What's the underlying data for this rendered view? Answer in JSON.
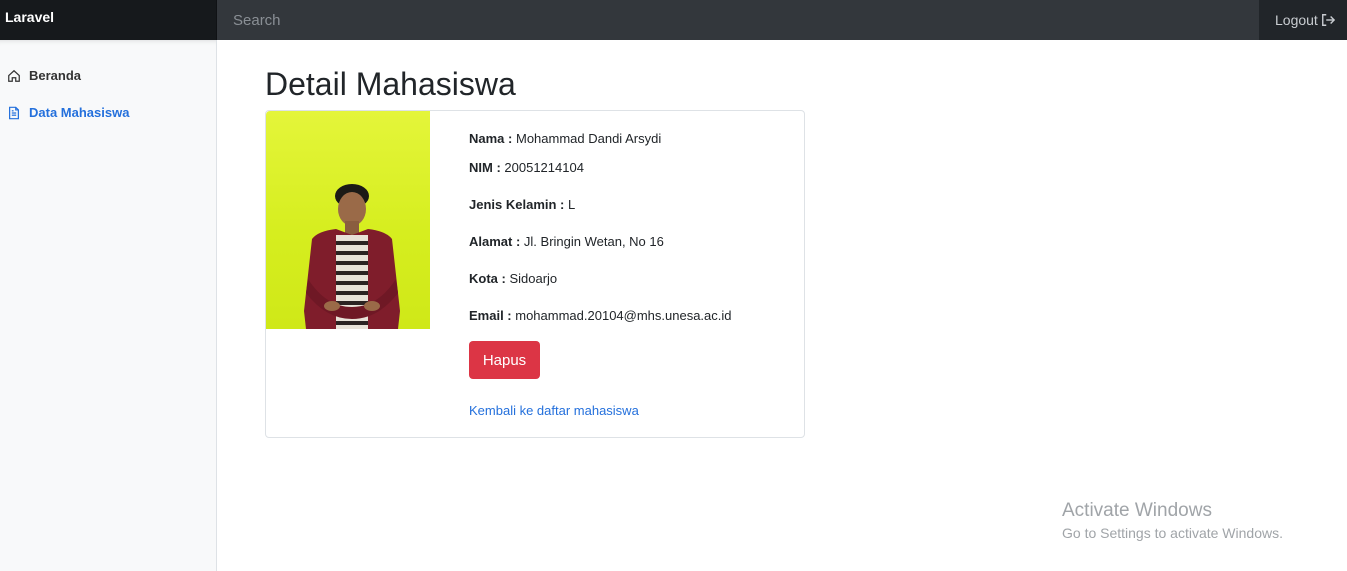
{
  "navbar": {
    "brand": "Laravel",
    "search_placeholder": "Search",
    "logout_label": "Logout"
  },
  "sidebar": {
    "items": [
      {
        "label": "Beranda",
        "icon": "home-icon",
        "active": false
      },
      {
        "label": "Data Mahasiswa",
        "icon": "file-text-icon",
        "active": true
      }
    ]
  },
  "page": {
    "title": "Detail Mahasiswa"
  },
  "student": {
    "nama_label": "Nama :",
    "nama": "Mohammad Dandi Arsydi",
    "nim_label": "NIM :",
    "nim": "20051214104",
    "jk_label": "Jenis Kelamin :",
    "jk": "L",
    "alamat_label": "Alamat :",
    "alamat": "Jl. Bringin Wetan, No 16",
    "kota_label": "Kota :",
    "kota": "Sidoarjo",
    "email_label": "Email :",
    "email": "mohammad.20104@mhs.unesa.ac.id"
  },
  "actions": {
    "delete_label": "Hapus",
    "back_label": "Kembali ke daftar mahasiswa"
  },
  "watermark": {
    "title": "Activate Windows",
    "subtitle": "Go to Settings to activate Windows."
  },
  "colors": {
    "navbar": "#212529",
    "brand_bg": "#16191c",
    "accent": "#2470dc",
    "danger": "#dc3545",
    "photo_bg": "#d6ee1f"
  }
}
